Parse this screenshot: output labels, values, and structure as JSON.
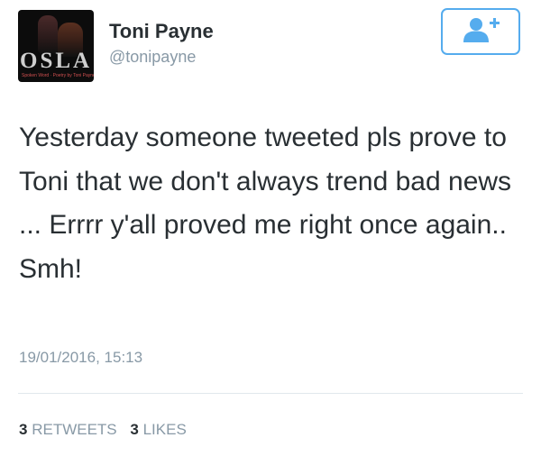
{
  "author": {
    "name": "Toni Payne",
    "handle": "@tonipayne",
    "avatar": {
      "logo_text": "OSLA",
      "tagline": "Spoken Word · Poetry by Toni Payne"
    }
  },
  "follow_button": {
    "icon": "add-user-icon",
    "color": "#55acee"
  },
  "tweet": {
    "text": "Yesterday someone tweeted pls prove to Toni that we don't always trend bad news ... Errrr y'all proved me right once again.. Smh!",
    "timestamp": "19/01/2016, 15:13"
  },
  "stats": {
    "retweets_count": "3",
    "retweets_label": "RETWEETS",
    "likes_count": "3",
    "likes_label": "LIKES"
  },
  "colors": {
    "text": "#292f33",
    "muted": "#8899a6",
    "accent": "#55acee",
    "divider": "#e1e8ed"
  }
}
